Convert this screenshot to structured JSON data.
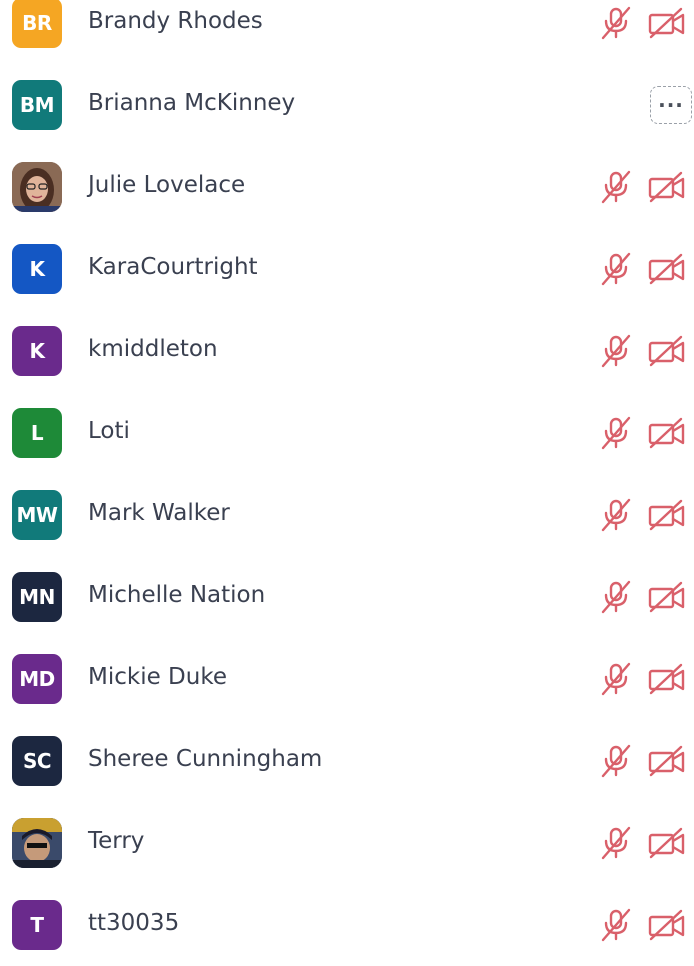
{
  "participants": [
    {
      "name": "Brandy Rhodes",
      "initials": "BR",
      "avatar_color": "#f5a623",
      "avatar_type": "initials",
      "mic": "muted",
      "video": "off"
    },
    {
      "name": "Brianna McKinney",
      "initials": "BM",
      "avatar_color": "#117a7a",
      "avatar_type": "initials",
      "mic": "none",
      "video": "none",
      "more_label": "···"
    },
    {
      "name": "Julie Lovelace",
      "initials": "",
      "avatar_color": "#6b4a3a",
      "avatar_type": "photo",
      "mic": "muted",
      "video": "off"
    },
    {
      "name": "KaraCourtright",
      "initials": "K",
      "avatar_color": "#1457c4",
      "avatar_type": "initials",
      "mic": "muted",
      "video": "off"
    },
    {
      "name": "kmiddleton",
      "initials": "K",
      "avatar_color": "#6a2a8c",
      "avatar_type": "initials",
      "mic": "muted",
      "video": "off"
    },
    {
      "name": "Loti",
      "initials": "L",
      "avatar_color": "#1e8a38",
      "avatar_type": "initials",
      "mic": "muted",
      "video": "off"
    },
    {
      "name": "Mark Walker",
      "initials": "MW",
      "avatar_color": "#117a7a",
      "avatar_type": "initials",
      "mic": "muted",
      "video": "off"
    },
    {
      "name": "Michelle Nation",
      "initials": "MN",
      "avatar_color": "#1c2740",
      "avatar_type": "initials",
      "mic": "muted",
      "video": "off"
    },
    {
      "name": "Mickie Duke",
      "initials": "MD",
      "avatar_color": "#6a2a8c",
      "avatar_type": "initials",
      "mic": "muted",
      "video": "off"
    },
    {
      "name": "Sheree Cunningham",
      "initials": "SC",
      "avatar_color": "#1c2740",
      "avatar_type": "initials",
      "mic": "muted",
      "video": "off"
    },
    {
      "name": "Terry",
      "initials": "",
      "avatar_color": "#2a3a5a",
      "avatar_type": "photo",
      "mic": "muted",
      "video": "off"
    },
    {
      "name": "tt30035",
      "initials": "T",
      "avatar_color": "#6a2a8c",
      "avatar_type": "initials",
      "mic": "muted",
      "video": "off"
    }
  ],
  "colors": {
    "muted_icon": "#d9606a",
    "name_text": "#3a4050"
  },
  "icons": {
    "mic": "mic-muted-icon",
    "video": "video-off-icon",
    "more": "more-options-icon"
  }
}
